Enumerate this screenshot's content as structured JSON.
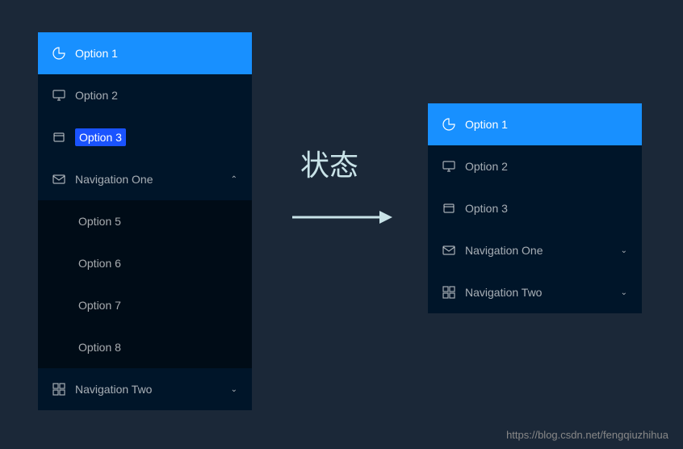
{
  "center_text": "状态",
  "watermark": "https://blog.csdn.net/fengqiuzhihua",
  "menu_left": {
    "items": [
      {
        "label": "Option 1",
        "icon": "pie",
        "active": true
      },
      {
        "label": "Option 2",
        "icon": "monitor"
      },
      {
        "label": "Option 3",
        "icon": "box",
        "highlighted": true
      },
      {
        "label": "Navigation One",
        "icon": "mail",
        "expanded": true
      }
    ],
    "sub_items": [
      {
        "label": "Option 5"
      },
      {
        "label": "Option 6"
      },
      {
        "label": "Option 7"
      },
      {
        "label": "Option 8"
      }
    ],
    "footer": {
      "label": "Navigation Two",
      "icon": "grid",
      "expanded": false
    }
  },
  "menu_right": {
    "items": [
      {
        "label": "Option 1",
        "icon": "pie",
        "active": true
      },
      {
        "label": "Option 2",
        "icon": "monitor"
      },
      {
        "label": "Option 3",
        "icon": "box"
      },
      {
        "label": "Navigation One",
        "icon": "mail",
        "expanded": false
      },
      {
        "label": "Navigation Two",
        "icon": "grid",
        "expanded": false
      }
    ]
  }
}
